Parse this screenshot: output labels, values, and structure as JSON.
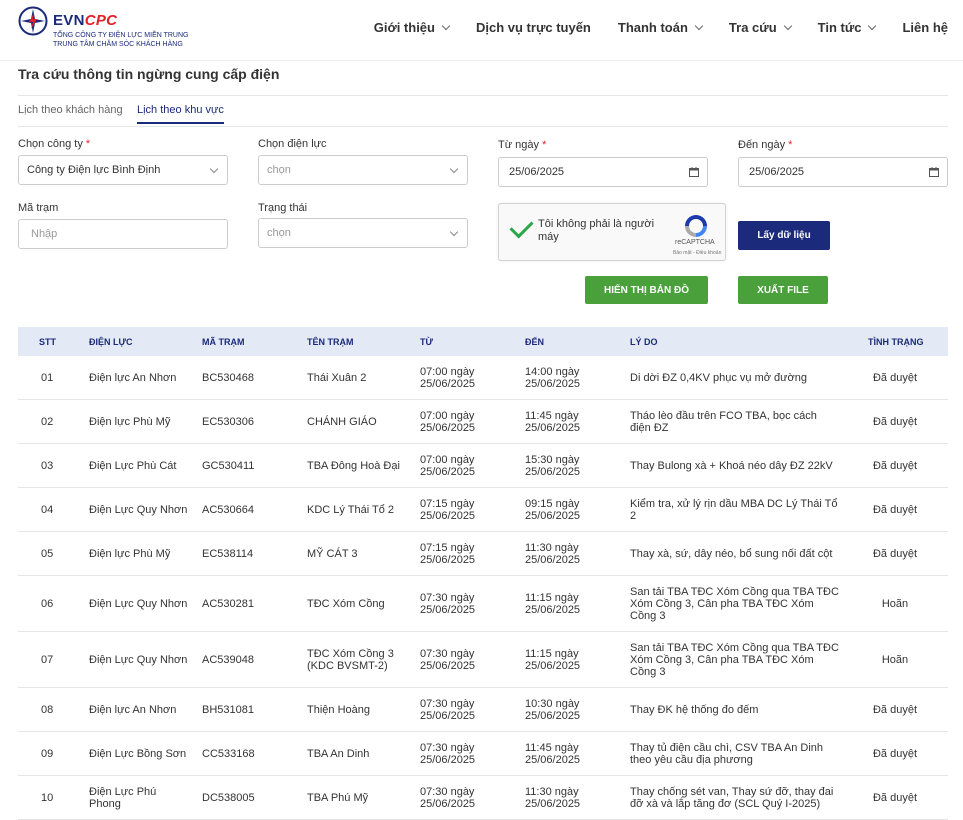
{
  "header": {
    "brand_evn": "EVN",
    "brand_cpc": "CPC",
    "sub1": "TỔNG CÔNG TY ĐIỆN LỰC MIỀN TRUNG",
    "sub2": "TRUNG TÂM CHĂM SÓC KHÁCH HÀNG",
    "nav": [
      {
        "label": "Giới thiệu",
        "dropdown": true
      },
      {
        "label": "Dịch vụ trực tuyến",
        "dropdown": false
      },
      {
        "label": "Thanh toán",
        "dropdown": true
      },
      {
        "label": "Tra cứu",
        "dropdown": true
      },
      {
        "label": "Tin tức",
        "dropdown": true
      },
      {
        "label": "Liên hệ",
        "dropdown": false
      }
    ]
  },
  "page": {
    "title": "Tra cứu thông tin ngừng cung cấp điện"
  },
  "tabs": [
    {
      "label": "Lịch theo khách hàng",
      "active": false
    },
    {
      "label": "Lịch theo khu vực",
      "active": true
    }
  ],
  "form": {
    "company_label": "Chọn công ty",
    "company_value": "Công ty Điện lực Bình Định",
    "dienluc_label": "Chọn điện lực",
    "dienluc_value": "chọn",
    "from_label": "Từ ngày",
    "from_value": "25/06/2025",
    "to_label": "Đến ngày",
    "to_value": "25/06/2025",
    "matram_label": "Mã trạm",
    "matram_placeholder": "Nhập",
    "status_label": "Trạng thái",
    "status_value": "chọn",
    "required_mark": "*",
    "captcha_text": "Tôi không phải là người máy",
    "captcha_brand": "reCAPTCHA",
    "captcha_links": "Bảo mật - Điều khoản",
    "btn_get": "Lấy dữ liệu",
    "btn_map": "HIỂN THỊ BẢN ĐỒ",
    "btn_export": "XUẤT FILE"
  },
  "colors": {
    "primary": "#1b2a7a",
    "green": "#4aa13c",
    "required": "#e32028",
    "thead_bg": "#e3eaf6"
  },
  "table": {
    "headers": [
      "STT",
      "ĐIỆN LỰC",
      "MÃ TRẠM",
      "TÊN TRẠM",
      "TỪ",
      "ĐẾN",
      "LÝ DO",
      "TÌNH TRẠNG"
    ],
    "rows": [
      {
        "stt": "01",
        "dl": "Điện lực An Nhơn",
        "ma": "BC530468",
        "ten": "Thái Xuân 2",
        "tu": "07:00 ngày 25/06/2025",
        "den": "14:00 ngày 25/06/2025",
        "ly": "Di dời ĐZ 0,4KV phục vụ mở đường",
        "tt": "Đã duyệt"
      },
      {
        "stt": "02",
        "dl": "Điện lực Phù Mỹ",
        "ma": "EC530306",
        "ten": "CHÁNH GIÁO",
        "tu": "07:00 ngày 25/06/2025",
        "den": "11:45 ngày 25/06/2025",
        "ly": "Tháo lèo đầu trên FCO TBA, bọc cách điện ĐZ",
        "tt": "Đã duyệt"
      },
      {
        "stt": "03",
        "dl": "Điện Lực Phù Cát",
        "ma": "GC530411",
        "ten": "TBA Đông Hoà Đại",
        "tu": "07:00 ngày 25/06/2025",
        "den": "15:30 ngày 25/06/2025",
        "ly": "Thay Bulong xà + Khoá néo dây ĐZ 22kV",
        "tt": "Đã duyệt"
      },
      {
        "stt": "04",
        "dl": "Điện Lực Quy Nhơn",
        "ma": "AC530664",
        "ten": "KDC Lý Thái Tổ 2",
        "tu": "07:15 ngày 25/06/2025",
        "den": "09:15 ngày 25/06/2025",
        "ly": "Kiểm tra, xử lý rịn dầu MBA DC Lý Thái Tổ 2",
        "tt": "Đã duyệt"
      },
      {
        "stt": "05",
        "dl": "Điện lực Phù Mỹ",
        "ma": "EC538114",
        "ten": "MỸ CÁT 3",
        "tu": "07:15 ngày 25/06/2025",
        "den": "11:30 ngày 25/06/2025",
        "ly": "Thay xà, sứ, dây néo, bổ sung nối đất cột",
        "tt": "Đã duyệt"
      },
      {
        "stt": "06",
        "dl": "Điện Lực Quy Nhơn",
        "ma": "AC530281",
        "ten": "TĐC Xóm Cồng",
        "tu": "07:30 ngày 25/06/2025",
        "den": "11:15 ngày 25/06/2025",
        "ly": "San tải TBA TĐC Xóm Cồng qua TBA TĐC Xóm Cồng 3, Cân pha TBA TĐC Xóm Cồng 3",
        "tt": "Hoãn"
      },
      {
        "stt": "07",
        "dl": "Điện Lực Quy Nhơn",
        "ma": "AC539048",
        "ten": "TĐC Xóm Cồng 3 (KDC BVSMT-2)",
        "tu": "07:30 ngày 25/06/2025",
        "den": "11:15 ngày 25/06/2025",
        "ly": "San tải TBA TĐC Xóm Cồng qua TBA TĐC Xóm Cồng 3, Cân pha TBA TĐC Xóm Cồng 3",
        "tt": "Hoãn"
      },
      {
        "stt": "08",
        "dl": "Điện lực An Nhơn",
        "ma": "BH531081",
        "ten": "Thiện Hoàng",
        "tu": "07:30 ngày 25/06/2025",
        "den": "10:30 ngày 25/06/2025",
        "ly": "Thay ĐK hệ thống đo đếm",
        "tt": "Đã duyệt"
      },
      {
        "stt": "09",
        "dl": "Điện Lực Bồng Sơn",
        "ma": "CC533168",
        "ten": "TBA An Dinh",
        "tu": "07:30 ngày 25/06/2025",
        "den": "11:45 ngày 25/06/2025",
        "ly": "Thay tủ điện cầu chì, CSV TBA An Dinh theo yêu cầu địa phương",
        "tt": "Đã duyệt"
      },
      {
        "stt": "10",
        "dl": "Điện Lực Phú Phong",
        "ma": "DC538005",
        "ten": "TBA Phú Mỹ",
        "tu": "07:30 ngày 25/06/2025",
        "den": "11:30 ngày 25/06/2025",
        "ly": "Thay chống sét van, Thay sứ đỡ, thay đai đỡ xà và lắp tăng đơ (SCL Quý I-2025)",
        "tt": "Đã duyệt"
      }
    ]
  }
}
